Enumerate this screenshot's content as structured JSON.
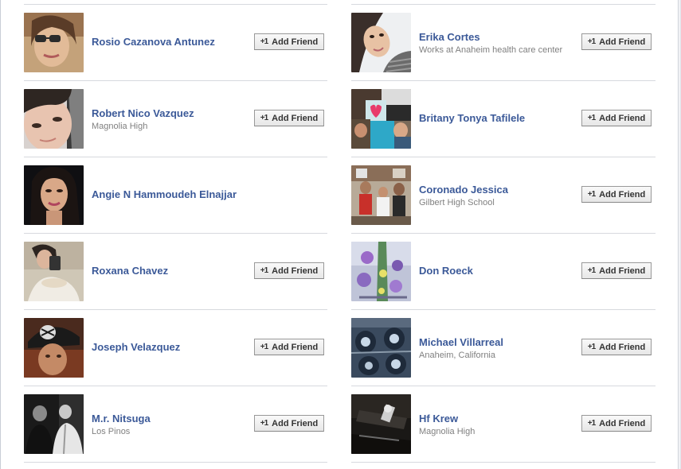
{
  "add_friend_icon": "+1",
  "left": [
    {
      "name": "Rosio Cazanova Antunez",
      "sub": "",
      "button": "Add Friend",
      "has_button": true,
      "photo": "woman-sunglasses-photo"
    },
    {
      "name": "Robert Nico Vazquez",
      "sub": "Magnolia High",
      "button": "Add Friend",
      "has_button": true,
      "photo": "boy-closeup-photo"
    },
    {
      "name": "Angie N Hammoudeh Elnajjar",
      "sub": "",
      "button": "",
      "has_button": false,
      "photo": "woman-portrait-photo"
    },
    {
      "name": "Roxana Chavez",
      "sub": "",
      "button": "Add Friend",
      "has_button": true,
      "photo": "woman-selfie-photo"
    },
    {
      "name": "Joseph Velazquez",
      "sub": "",
      "button": "Add Friend",
      "has_button": true,
      "photo": "raiders-cap-photo"
    },
    {
      "name": "M.r. Nitsuga",
      "sub": "Los Pinos",
      "button": "Add Friend",
      "has_button": true,
      "photo": "two-men-bw-photo"
    }
  ],
  "right": [
    {
      "name": "Erika Cortes",
      "sub": "Works at Anaheim health care center",
      "button": "Add Friend",
      "has_button": true,
      "photo": "woman-tilted-photo"
    },
    {
      "name": "Britany Tonya Tafilele",
      "sub": "",
      "button": "Add Friend",
      "has_button": true,
      "photo": "collage-photo"
    },
    {
      "name": "Coronado Jessica",
      "sub": "Gilbert High School",
      "button": "Add Friend",
      "has_button": true,
      "photo": "group-kids-photo"
    },
    {
      "name": "Don Roeck",
      "sub": "",
      "button": "Add Friend",
      "has_button": true,
      "photo": "painted-pole-photo"
    },
    {
      "name": "Michael Villarreal",
      "sub": "Anaheim, California",
      "button": "Add Friend",
      "has_button": true,
      "photo": "skateboards-photo"
    },
    {
      "name": "Hf Krew",
      "sub": "Magnolia High",
      "button": "Add Friend",
      "has_button": true,
      "photo": "music-gear-photo"
    }
  ]
}
